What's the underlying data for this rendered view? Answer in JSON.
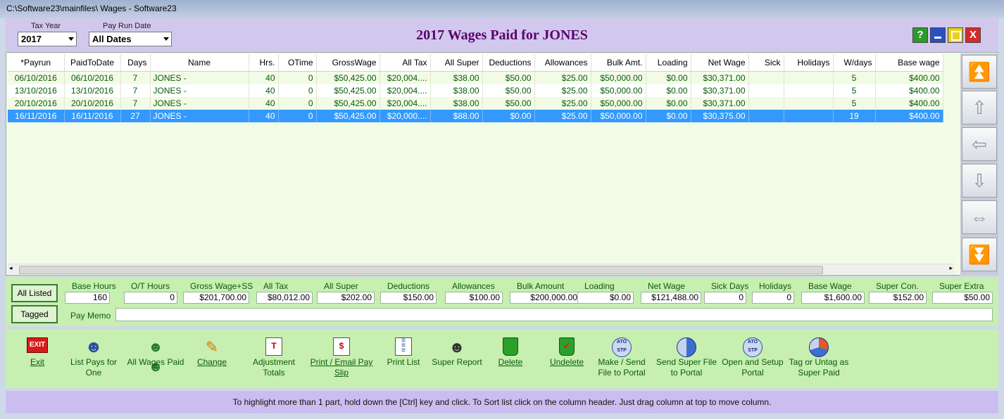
{
  "window": {
    "title": "C:\\Software23\\mainfiles\\ Wages - Software23"
  },
  "header": {
    "tax_year_label": "Tax Year",
    "tax_year_value": "2017",
    "pay_run_label": "Pay Run Date",
    "pay_run_value": "All Dates",
    "title": "2017 Wages Paid for  JONES",
    "help_btn": "?",
    "min_btn": "",
    "max_btn": "",
    "close_btn": "X"
  },
  "grid": {
    "columns": [
      "*Payrun",
      "PaidToDate",
      "Days",
      "Name",
      "Hrs.",
      "OTime",
      "GrossWage",
      "All Tax",
      "All Super",
      "Deductions",
      "Allowances",
      "Bulk Amt.",
      "Loading",
      "Net Wage",
      "Sick",
      "Holidays",
      "W/days",
      "Base wage"
    ],
    "rows": [
      [
        "06/10/2016",
        "06/10/2016",
        "7",
        "JONES -",
        "40",
        "0",
        "$50,425.00",
        "$20,004....",
        "$38.00",
        "$50.00",
        "$25.00",
        "$50,000.00",
        "$0.00",
        "$30,371.00",
        "",
        "",
        "5",
        "$400.00"
      ],
      [
        "13/10/2016",
        "13/10/2016",
        "7",
        "JONES -",
        "40",
        "0",
        "$50,425.00",
        "$20,004....",
        "$38.00",
        "$50.00",
        "$25.00",
        "$50,000.00",
        "$0.00",
        "$30,371.00",
        "",
        "",
        "5",
        "$400.00"
      ],
      [
        "20/10/2016",
        "20/10/2016",
        "7",
        "JONES -",
        "40",
        "0",
        "$50,425.00",
        "$20,004....",
        "$38.00",
        "$50.00",
        "$25.00",
        "$50,000.00",
        "$0.00",
        "$30,371.00",
        "",
        "",
        "5",
        "$400.00"
      ],
      [
        "16/11/2016",
        "16/11/2016",
        "27",
        "JONES -",
        "40",
        "0",
        "$50,425.00",
        "$20,000....",
        "$88.00",
        "$0.00",
        "$25.00",
        "$50,000.00",
        "$0.00",
        "$30,375.00",
        "",
        "",
        "19",
        "$400.00"
      ]
    ],
    "selected_row": 3
  },
  "nav_icons": [
    "top-icon",
    "up-icon",
    "left-icon",
    "down-icon",
    "left-right-icon",
    "bottom-icon"
  ],
  "totals": {
    "all_listed_btn": "All Listed",
    "tagged_btn": "Tagged",
    "pay_memo_label": "Pay Memo",
    "items": [
      {
        "label": "Base Hours",
        "value": "160"
      },
      {
        "label": "O/T Hours",
        "value": "0"
      },
      {
        "label": "Gross Wage+SS",
        "value": "$201,700.00"
      },
      {
        "label": "All Tax",
        "value": "$80,012.00"
      },
      {
        "label": "All Super",
        "value": "$202.00"
      },
      {
        "label": "Deductions",
        "value": "$150.00"
      },
      {
        "label": "Allowances",
        "value": "$100.00"
      },
      {
        "label": "Bulk Amount",
        "value": "$200,000.00"
      },
      {
        "label": "Loading",
        "value": "$0.00"
      },
      {
        "label": "Net Wage",
        "value": "$121,488.00"
      },
      {
        "label": "Sick Days",
        "value": "0"
      },
      {
        "label": "Holidays",
        "value": "0"
      },
      {
        "label": "Base Wage",
        "value": "$1,600.00"
      },
      {
        "label": "Super Con.",
        "value": "$152.00"
      },
      {
        "label": "Super Extra",
        "value": "$50.00"
      }
    ]
  },
  "toolbar": [
    {
      "label": "Exit",
      "icon": "exit-icon"
    },
    {
      "label": "List Pays for One",
      "icon": "person-icon"
    },
    {
      "label": "All Wages Paid",
      "icon": "people-icon"
    },
    {
      "label": "Change",
      "icon": "pencil-icon"
    },
    {
      "label": "Adjustment Totals",
      "icon": "document-icon"
    },
    {
      "label": "Print / Email Pay Slip",
      "icon": "payslip-icon"
    },
    {
      "label": "Print List",
      "icon": "print-list-icon"
    },
    {
      "label": "Super Report",
      "icon": "report-icon"
    },
    {
      "label": "Delete",
      "icon": "trash-icon"
    },
    {
      "label": "Undelete",
      "icon": "undelete-icon"
    },
    {
      "label": "Make / Send File to Portal",
      "icon": "ato-stp-icon"
    },
    {
      "label": "Send Super File to Portal",
      "icon": "super-portal-icon"
    },
    {
      "label": "Open and Setup Portal",
      "icon": "ato-setup-icon"
    },
    {
      "label": "Tag or Untag as Super Paid",
      "icon": "tag-super-icon"
    }
  ],
  "status": "To highlight more than 1 part, hold down the [Ctrl] key and click.    To Sort list click on the column header.   Just drag column at top to move column.",
  "colors": {
    "accent": "#5a0070",
    "grid_text": "#0a5a0a",
    "selection": "#3399ff",
    "panel_green": "#c6efb0",
    "title_lavender": "#d2c7ec"
  }
}
